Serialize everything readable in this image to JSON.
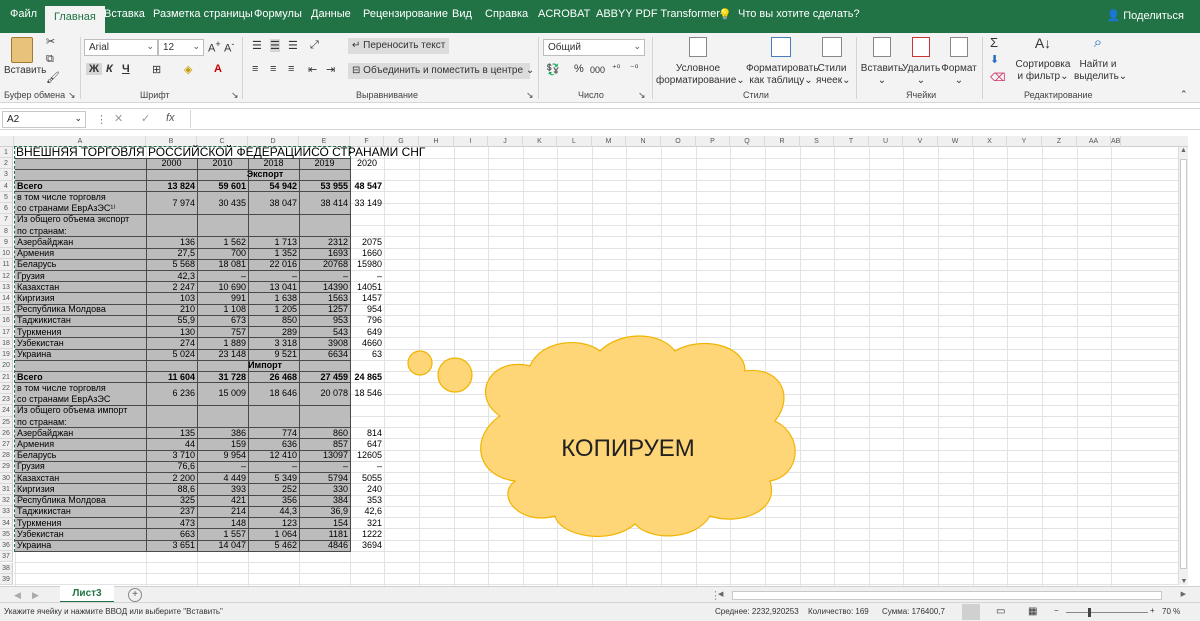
{
  "tabs": [
    "Файл",
    "Главная",
    "Вставка",
    "Разметка страницы",
    "Формулы",
    "Данные",
    "Рецензирование",
    "Вид",
    "Справка",
    "ACROBAT",
    "ABBYY PDF Transformer+"
  ],
  "tell_me": "Что вы хотите сделать?",
  "share": "Поделиться",
  "ribbon": {
    "paste": "Вставить",
    "clipboard": "Буфер обмена",
    "font_name": "Arial",
    "font_size": "12",
    "font": "Шрифт",
    "bold": "Ж",
    "italic": "К",
    "underline": "Ч",
    "wrap": "Переносить текст",
    "merge": "Объединить и поместить в центре",
    "alignment": "Выравнивание",
    "num_format": "Общий",
    "number": "Число",
    "percent": "%",
    "thousands": "000",
    "cond1": "Условное",
    "cond2": "форматирование",
    "fmt1": "Форматировать",
    "fmt2": "как таблицу",
    "sty1": "Стили",
    "sty2": "ячеек",
    "styles": "Стили",
    "ins": "Вставить",
    "del": "Удалить",
    "fmtc": "Формат",
    "cells": "Ячейки",
    "sort1": "Сортировка",
    "sort2": "и фильтр",
    "find1": "Найти и",
    "find2": "выделить",
    "editing": "Редактирование"
  },
  "formula_bar": {
    "name_box": "A2",
    "fx": "fx"
  },
  "cols": [
    "A",
    "B",
    "C",
    "D",
    "E",
    "F",
    "G",
    "H",
    "I",
    "J",
    "K",
    "L",
    "M",
    "N",
    "O",
    "P",
    "Q",
    "R",
    "S",
    "T",
    "U",
    "V",
    "W",
    "X",
    "Y",
    "Z",
    "AA",
    "AB"
  ],
  "title": "ВНЕШНЯЯ ТОРГОВЛЯ РОССИЙСКОЙ ФЕДЕРАЦИИСО СТРАНАМИ СНГ",
  "years": [
    "2000",
    "2010",
    "2018",
    "2019",
    "2020"
  ],
  "export": "Экспорт",
  "import": "Импорт",
  "rows": [
    {
      "r": 4,
      "l": "Всего",
      "v": [
        "13 824",
        "59 601",
        "54 942",
        "53 955",
        "48 547"
      ],
      "b": true
    },
    {
      "r": 5,
      "l": "в том числе торговля",
      "l2": "со странами ЕврАзЭС¹⁾",
      "v": [
        "7 974",
        "30 435",
        "38 047",
        "38 414",
        "33 149"
      ],
      "two": true
    },
    {
      "r": 7,
      "l": "Из общего объема экспорт",
      "l2": "по странам:",
      "v": [
        "",
        "",
        "",
        "",
        ""
      ],
      "two": true
    },
    {
      "r": 9,
      "l": "Азербайджан",
      "v": [
        "136",
        "1 562",
        "1 713",
        "2312",
        "2075"
      ]
    },
    {
      "r": 10,
      "l": "Армения",
      "v": [
        "27,5",
        "700",
        "1 352",
        "1693",
        "1660"
      ]
    },
    {
      "r": 11,
      "l": "Беларусь",
      "v": [
        "5 568",
        "18 081",
        "22 016",
        "20768",
        "15980"
      ]
    },
    {
      "r": 12,
      "l": "Грузия",
      "v": [
        "42,3",
        "–",
        "–",
        "–",
        "–"
      ]
    },
    {
      "r": 13,
      "l": "Казахстан",
      "v": [
        "2 247",
        "10 690",
        "13 041",
        "14390",
        "14051"
      ]
    },
    {
      "r": 14,
      "l": "Киргизия",
      "v": [
        "103",
        "991",
        "1 638",
        "1563",
        "1457"
      ]
    },
    {
      "r": 15,
      "l": "Республика Молдова",
      "v": [
        "210",
        "1 108",
        "1 205",
        "1257",
        "954"
      ]
    },
    {
      "r": 16,
      "l": "Таджикистан",
      "v": [
        "55,9",
        "673",
        "850",
        "953",
        "796"
      ]
    },
    {
      "r": 17,
      "l": "Туркмения",
      "v": [
        "130",
        "757",
        "289",
        "543",
        "649"
      ]
    },
    {
      "r": 18,
      "l": "Узбекистан",
      "v": [
        "274",
        "1 889",
        "3 318",
        "3908",
        "4660"
      ]
    },
    {
      "r": 19,
      "l": "Украина",
      "v": [
        "5 024",
        "23 148",
        "9 521",
        "6634",
        "63"
      ]
    },
    {
      "r": 21,
      "l": "Всего",
      "v": [
        "11 604",
        "31 728",
        "26 468",
        "27 459",
        "24 865"
      ],
      "b": true
    },
    {
      "r": 22,
      "l": "в том числе торговля",
      "l2": "со странами ЕврАзЭС",
      "v": [
        "6 236",
        "15 009",
        "18 646",
        "20 078",
        "18 546"
      ],
      "two": true
    },
    {
      "r": 24,
      "l": "Из общего объема импорт",
      "l2": "по странам:",
      "v": [
        "",
        "",
        "",
        "",
        ""
      ],
      "two": true
    },
    {
      "r": 26,
      "l": "Азербайджан",
      "v": [
        "135",
        "386",
        "774",
        "860",
        "814"
      ]
    },
    {
      "r": 27,
      "l": "Армения",
      "v": [
        "44",
        "159",
        "636",
        "857",
        "647"
      ]
    },
    {
      "r": 28,
      "l": "Беларусь",
      "v": [
        "3 710",
        "9 954",
        "12 410",
        "13097",
        "12605"
      ]
    },
    {
      "r": 29,
      "l": "Грузия",
      "v": [
        "76,6",
        "–",
        "–",
        "–",
        "–"
      ]
    },
    {
      "r": 30,
      "l": "Казахстан",
      "v": [
        "2 200",
        "4 449",
        "5 349",
        "5794",
        "5055"
      ]
    },
    {
      "r": 31,
      "l": "Киргизия",
      "v": [
        "88,6",
        "393",
        "252",
        "330",
        "240"
      ]
    },
    {
      "r": 32,
      "l": "Республика Молдова",
      "v": [
        "325",
        "421",
        "356",
        "384",
        "353"
      ]
    },
    {
      "r": 33,
      "l": "Таджикистан",
      "v": [
        "237",
        "214",
        "44,3",
        "36,9",
        "42,6"
      ]
    },
    {
      "r": 34,
      "l": "Туркмения",
      "v": [
        "473",
        "148",
        "123",
        "154",
        "321"
      ]
    },
    {
      "r": 35,
      "l": "Узбекистан",
      "v": [
        "663",
        "1 557",
        "1 064",
        "1181",
        "1222"
      ]
    },
    {
      "r": 36,
      "l": "Украина",
      "v": [
        "3 651",
        "14 047",
        "5 462",
        "4846",
        "3694"
      ]
    }
  ],
  "callout": "КОПИРУЕМ",
  "sheet_tab": "Лист3",
  "status": {
    "hint": "Укажите ячейку и нажмите ВВОД или выберите \"Вставить\"",
    "avg": "Среднее: 2232,920253",
    "count": "Количество: 169",
    "sum": "Сумма: 176400,7",
    "zoom": "70 %"
  },
  "colors": {
    "excel_green": "#217346",
    "callout_fill": "#ffd677",
    "callout_border": "#f0b400",
    "selection_gray": "#bcbcbc"
  }
}
